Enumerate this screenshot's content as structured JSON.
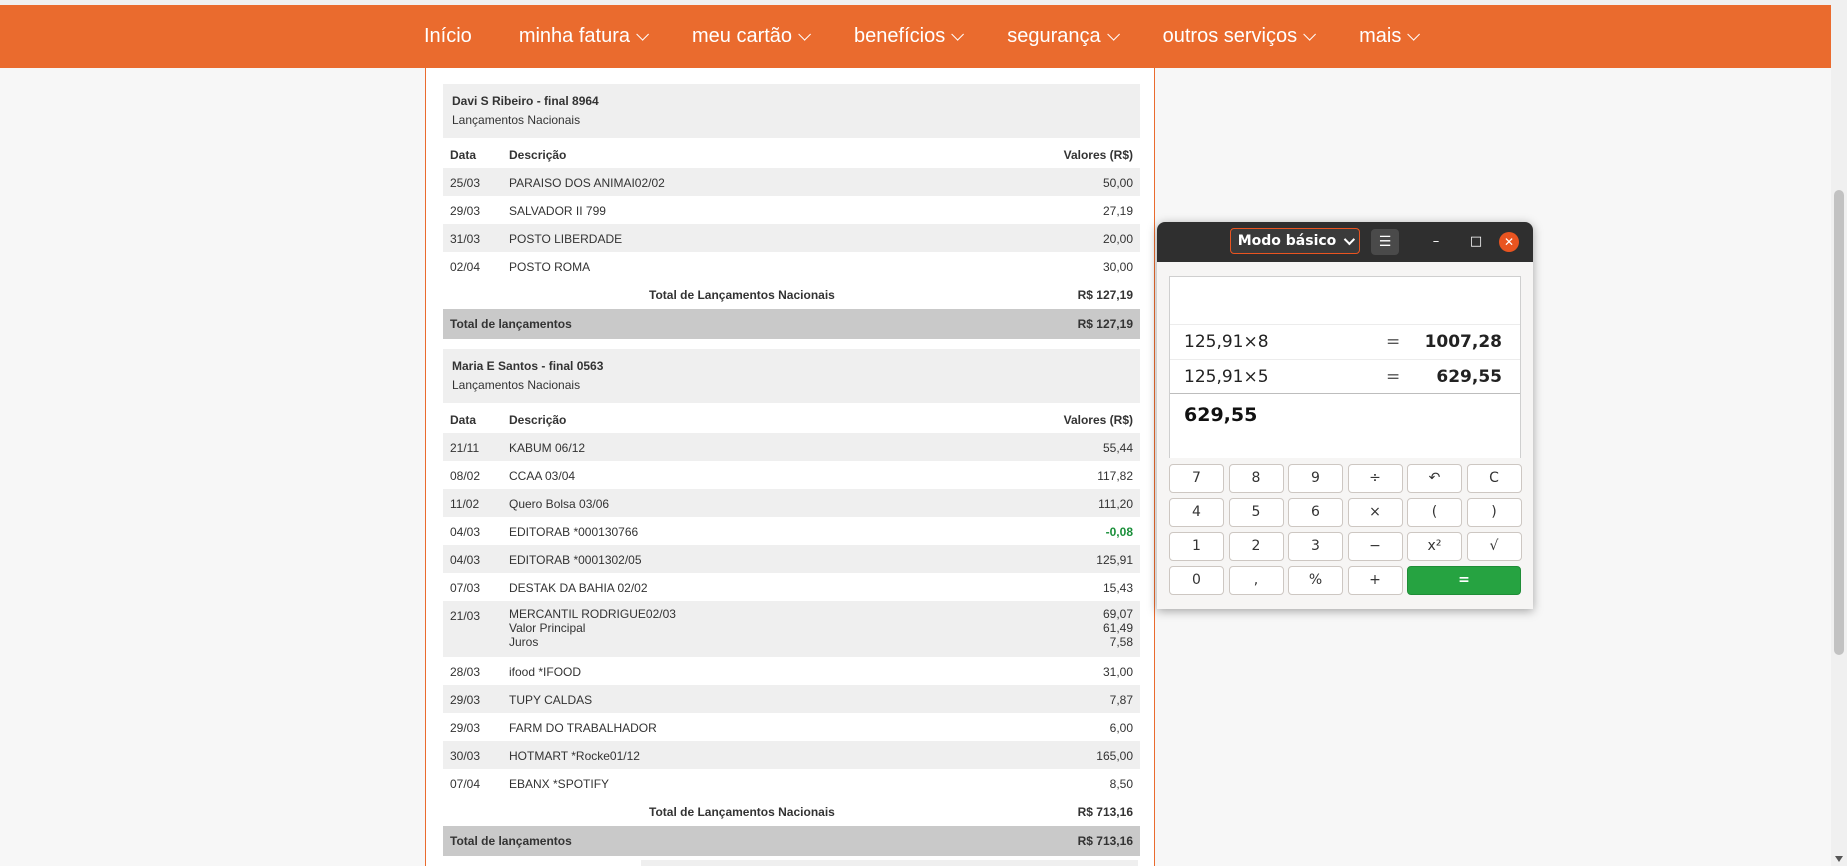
{
  "nav": {
    "items": [
      {
        "label": "Início",
        "has_menu": false
      },
      {
        "label": "minha fatura",
        "has_menu": true
      },
      {
        "label": "meu cartão",
        "has_menu": true
      },
      {
        "label": "benefícios",
        "has_menu": true
      },
      {
        "label": "segurança",
        "has_menu": true
      },
      {
        "label": "outros serviços",
        "has_menu": true
      },
      {
        "label": "mais",
        "has_menu": true
      }
    ],
    "color": "#ea6b2e"
  },
  "statement": {
    "headers": {
      "date": "Data",
      "desc": "Descrição",
      "value": "Valores (R$)"
    },
    "cards": [
      {
        "name": "Davi S Ribeiro - final 8964",
        "section": "Lançamentos Nacionais",
        "rows": [
          {
            "date": "25/03",
            "desc": "PARAISO DOS ANIMAI02/02",
            "value": "50,00"
          },
          {
            "date": "29/03",
            "desc": "SALVADOR II 799",
            "value": "27,19"
          },
          {
            "date": "31/03",
            "desc": "POSTO LIBERDADE",
            "value": "20,00"
          },
          {
            "date": "02/04",
            "desc": "POSTO ROMA",
            "value": "30,00"
          }
        ],
        "subtotal_label": "Total de Lançamentos Nacionais",
        "subtotal_value": "R$ 127,19",
        "total_label": "Total de lançamentos",
        "total_value": "R$ 127,19"
      },
      {
        "name": "Maria E Santos - final 0563",
        "section": "Lançamentos Nacionais",
        "rows": [
          {
            "date": "21/11",
            "desc": "KABUM 06/12",
            "value": "55,44"
          },
          {
            "date": "08/02",
            "desc": "CCAA 03/04",
            "value": "117,82"
          },
          {
            "date": "11/02",
            "desc": "Quero Bolsa 03/06",
            "value": "111,20"
          },
          {
            "date": "04/03",
            "desc": "EDITORAB *000130766",
            "value": "-0,08"
          },
          {
            "date": "04/03",
            "desc": "EDITORAB *0001302/05",
            "value": "125,91"
          },
          {
            "date": "07/03",
            "desc": "DESTAK DA BAHIA 02/02",
            "value": "15,43"
          },
          {
            "date": "21/03",
            "desc": "MERCANTIL RODRIGUE02/03",
            "value": "69,07",
            "desc2": "Valor Principal",
            "value2": "61,49",
            "desc3": "Juros",
            "value3": "7,58"
          },
          {
            "date": "28/03",
            "desc": "ifood *IFOOD",
            "value": "31,00"
          },
          {
            "date": "29/03",
            "desc": "TUPY CALDAS",
            "value": "7,87"
          },
          {
            "date": "29/03",
            "desc": "FARM DO TRABALHADOR",
            "value": "6,00"
          },
          {
            "date": "30/03",
            "desc": "HOTMART *Rocke01/12",
            "value": "165,00"
          },
          {
            "date": "07/04",
            "desc": "EBANX *SPOTIFY",
            "value": "8,50"
          }
        ],
        "subtotal_label": "Total de Lançamentos Nacionais",
        "subtotal_value": "R$ 713,16",
        "total_label": "Total de lançamentos",
        "total_value": "R$ 713,16"
      }
    ]
  },
  "calculator": {
    "mode_label": "Modo básico",
    "menu_icon": "☰",
    "minimize": "–",
    "maximize": "□",
    "close": "✕",
    "history": [
      {
        "expr": "125,91×8",
        "eq": "=",
        "result": "1007,28"
      },
      {
        "expr": "125,91×5",
        "eq": "=",
        "result": "629,55"
      }
    ],
    "current": "629,55",
    "keys": [
      [
        "7",
        "8",
        "9",
        "÷",
        "↶",
        "C"
      ],
      [
        "4",
        "5",
        "6",
        "×",
        "(",
        ")"
      ],
      [
        "1",
        "2",
        "3",
        "−",
        "x²",
        "√"
      ],
      [
        "0",
        ",",
        "%",
        "+",
        "="
      ]
    ]
  }
}
